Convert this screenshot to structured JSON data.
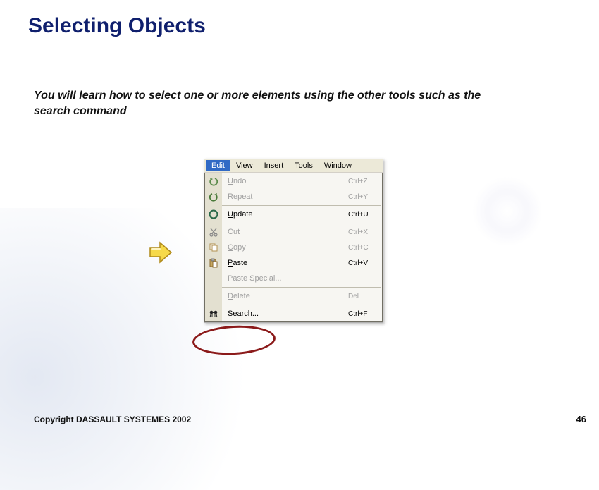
{
  "title": "Selecting Objects",
  "subtitle": "You will learn how to select one or more elements using the other tools such as the search command",
  "menubar": {
    "edit": "Edit",
    "view": "View",
    "insert": "Insert",
    "tools": "Tools",
    "window": "Window"
  },
  "menu": {
    "undo": {
      "label": "Undo",
      "shortcut": "Ctrl+Z"
    },
    "repeat": {
      "label": "Repeat",
      "shortcut": "Ctrl+Y"
    },
    "update": {
      "label": "Update",
      "shortcut": "Ctrl+U"
    },
    "cut": {
      "label": "Cut",
      "shortcut": "Ctrl+X"
    },
    "copy": {
      "label": "Copy",
      "shortcut": "Ctrl+C"
    },
    "paste": {
      "label": "Paste",
      "shortcut": "Ctrl+V"
    },
    "paste_special": {
      "label": "Paste Special...",
      "shortcut": ""
    },
    "delete": {
      "label": "Delete",
      "shortcut": "Del"
    },
    "search": {
      "label": "Search...",
      "shortcut": "Ctrl+F"
    }
  },
  "copyright": "Copyright DASSAULT SYSTEMES 2002",
  "page_number": "46"
}
